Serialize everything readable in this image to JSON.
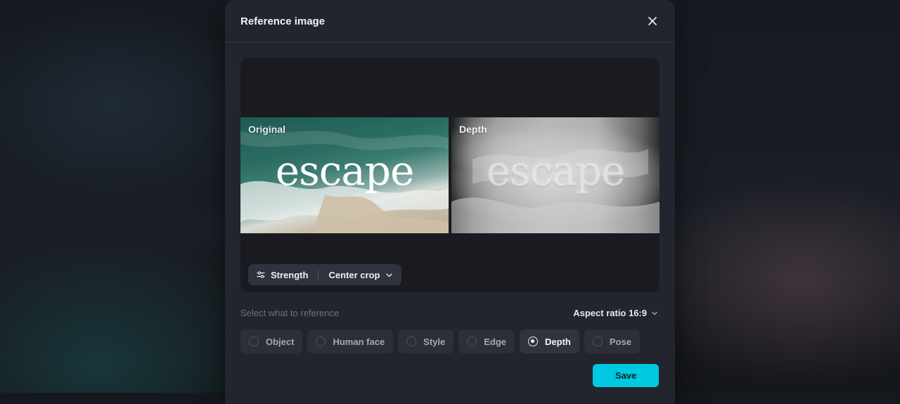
{
  "modal": {
    "title": "Reference image",
    "close_icon": "close-icon"
  },
  "preview": {
    "original_label": "Original",
    "depth_label": "Depth",
    "image_word": "escape"
  },
  "toolbar": {
    "strength_label": "Strength",
    "strength_icon": "sliders-icon",
    "crop_label": "Center crop",
    "crop_icon": "chevron-down-icon"
  },
  "reference": {
    "section_label": "Select what to reference",
    "aspect_label": "Aspect ratio 16:9",
    "options": [
      {
        "label": "Object",
        "selected": false
      },
      {
        "label": "Human face",
        "selected": false
      },
      {
        "label": "Style",
        "selected": false
      },
      {
        "label": "Edge",
        "selected": false
      },
      {
        "label": "Depth",
        "selected": true
      },
      {
        "label": "Pose",
        "selected": false
      }
    ]
  },
  "actions": {
    "save_label": "Save"
  },
  "colors": {
    "accent": "#00c8e0",
    "modal_bg": "#22252d",
    "option_bg": "#2c2f38"
  }
}
